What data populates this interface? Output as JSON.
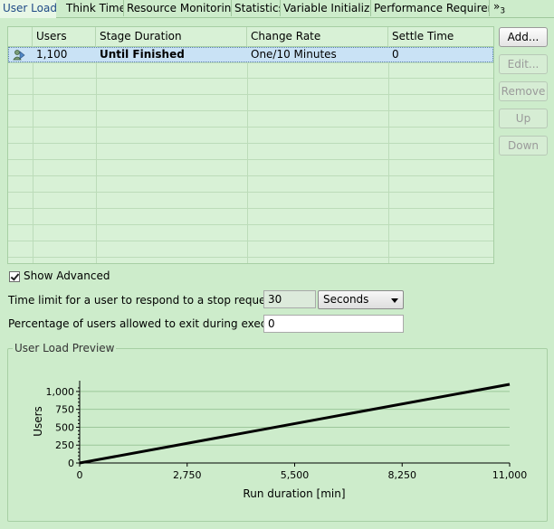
{
  "tabs": [
    {
      "label": "User Load",
      "active": true
    },
    {
      "label": "Think Time"
    },
    {
      "label": "Resource Monitoring"
    },
    {
      "label": "Statistics"
    },
    {
      "label": "Variable Initializat"
    },
    {
      "label": "Performance Requirem"
    }
  ],
  "tabs_overflow": {
    "symbol": "»",
    "count": "3"
  },
  "stage_table": {
    "columns": [
      "Users",
      "Stage Duration",
      "Change Rate",
      "Settle Time"
    ],
    "rows": [
      {
        "users": "1,100",
        "stage_duration": "Until Finished",
        "change_rate": "One/10 Minutes",
        "settle_time": "0"
      }
    ]
  },
  "buttons": {
    "add": "Add...",
    "edit": "Edit...",
    "remove": "Remove",
    "up": "Up",
    "down": "Down"
  },
  "advanced": {
    "show_advanced_label": "Show Advanced",
    "show_advanced_checked": true,
    "time_limit_label": "Time limit for a user to respond to a stop request:",
    "time_limit_value": "30",
    "time_unit": "Seconds",
    "exit_pct_label": "Percentage of users allowed to exit during execution:",
    "exit_pct_value": "0"
  },
  "preview": {
    "group_title": "User Load Preview"
  },
  "chart_data": {
    "type": "line",
    "title": "",
    "xlabel": "Run duration [min]",
    "ylabel": "Users",
    "xlim": [
      0,
      11000
    ],
    "ylim": [
      0,
      1100
    ],
    "x_ticks": [
      0,
      2750,
      5500,
      8250,
      11000
    ],
    "x_tick_labels": [
      "0",
      "2,750",
      "5,500",
      "8,250",
      "11,000"
    ],
    "y_ticks": [
      0,
      250,
      500,
      750,
      1000
    ],
    "y_tick_labels": [
      "0",
      "250",
      "500",
      "750",
      "1,000"
    ],
    "grid": true,
    "series": [
      {
        "x": [
          0,
          11000
        ],
        "y": [
          0,
          1100
        ],
        "color": "#000000"
      }
    ]
  }
}
